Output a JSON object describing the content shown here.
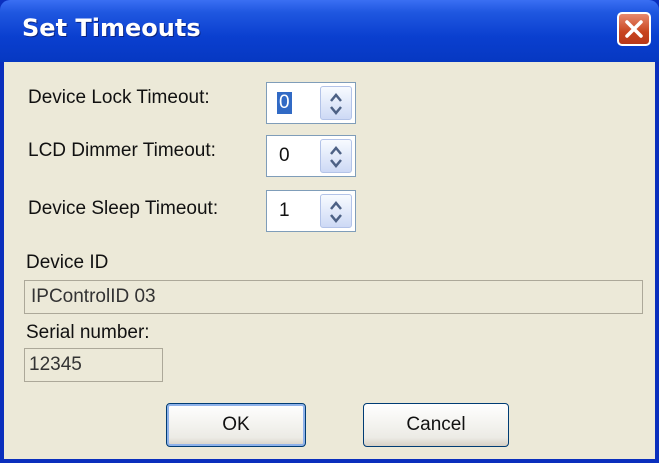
{
  "window": {
    "title": "Set Timeouts"
  },
  "icons": {
    "close": "close-icon",
    "spin_up": "chevron-up-icon",
    "spin_down": "chevron-down-icon"
  },
  "colors": {
    "title_bar": "#0a3fcf",
    "close_button": "#c8441f",
    "dialog_background": "#ece9d8",
    "selection": "#316ac5"
  },
  "timeouts": {
    "lock": {
      "label": "Device Lock Timeout:",
      "value": "0"
    },
    "dimmer": {
      "label": "LCD Dimmer Timeout:",
      "value": "0"
    },
    "sleep": {
      "label": "Device Sleep Timeout:",
      "value": "1"
    }
  },
  "device": {
    "id_label": "Device ID",
    "id_value": "IPControlID 03",
    "serial_label": "Serial number:",
    "serial_value": "12345"
  },
  "buttons": {
    "ok": "OK",
    "cancel": "Cancel"
  }
}
